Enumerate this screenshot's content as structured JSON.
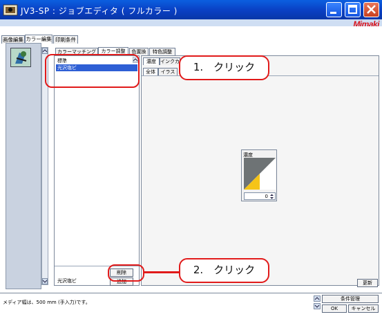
{
  "window": {
    "title": "JV3-SP : ジョブエディタ ( フルカラー )",
    "brand": "Mimaki"
  },
  "main_tabs": [
    "画像編集",
    "カラー編集",
    "印刷条件"
  ],
  "sub_tabs": [
    "カラーマッチング",
    "カラー調整",
    "色置換",
    "特色調整"
  ],
  "list": {
    "items": [
      "標準",
      "光沢塩ビ"
    ],
    "selected_index": 1,
    "footer_value": "光沢塩ビ"
  },
  "right_tabs": [
    "濃度",
    "インクカ"
  ],
  "right_subtabs": [
    "全体",
    "イラス"
  ],
  "density": {
    "label": "濃度",
    "value": "0"
  },
  "buttons": {
    "delete": "削除",
    "add": "追加",
    "update": "更新",
    "condition": "条件管理",
    "ok": "OK",
    "cancel": "キャンセル"
  },
  "status": {
    "message": "メディア幅は、500 mm (手入力)です。"
  },
  "callouts": {
    "step1": "1.　クリック",
    "step2": "2.　クリック"
  },
  "colors": {
    "accent_red": "#e11a1a",
    "selection": "#2e5fd5",
    "titlebar": "#0a3fc2",
    "density_yellow": "#f5c418",
    "density_gray": "#6e7375"
  }
}
